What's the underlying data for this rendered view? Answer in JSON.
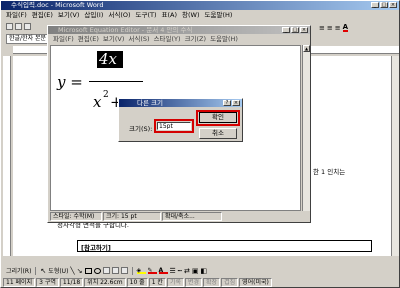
{
  "word": {
    "title": "수식입력.doc - Microsoft Word",
    "menu": [
      "파일(F)",
      "편집(E)",
      "보기(V)",
      "삽입(I)",
      "서식(O)",
      "도구(T)",
      "표(A)",
      "창(W)",
      "도움말(H)"
    ],
    "font_style": "한글/한자 본문",
    "doc_text_1": "한 1 인치는",
    "doc_text_2": "정사각형 면적을 구합니다.",
    "note": "[참고하기]",
    "draw_label": "그리기(R)",
    "autoshape_label": "도형(U)",
    "status": [
      "11 페이지",
      "3 구역",
      "11/18",
      "위치 22.6cm",
      "10 줄",
      "1 칸",
      "기록",
      "변경",
      "확장",
      "겹침",
      "영어(미국)"
    ]
  },
  "equation_editor": {
    "title": "Microsoft Equation Editor - 문서 4 안의 수식",
    "menu": [
      "파일(F)",
      "편집(E)",
      "보기(V)",
      "서식(S)",
      "스타일(Y)",
      "크기(Z)",
      "도움말(H)"
    ],
    "formula": {
      "lhs": "y =",
      "numerator": "4x",
      "denominator_base": "x",
      "denominator_exp": "2",
      "denominator_rest": "+"
    },
    "status": [
      "스타일: 수학(M)",
      "크기: 15 pt",
      "확대/축소..."
    ]
  },
  "dialog": {
    "title": "다른 크기",
    "size_label": "크기(S):",
    "size_value": "15pt",
    "ok_label": "확인",
    "cancel_label": "취소"
  }
}
